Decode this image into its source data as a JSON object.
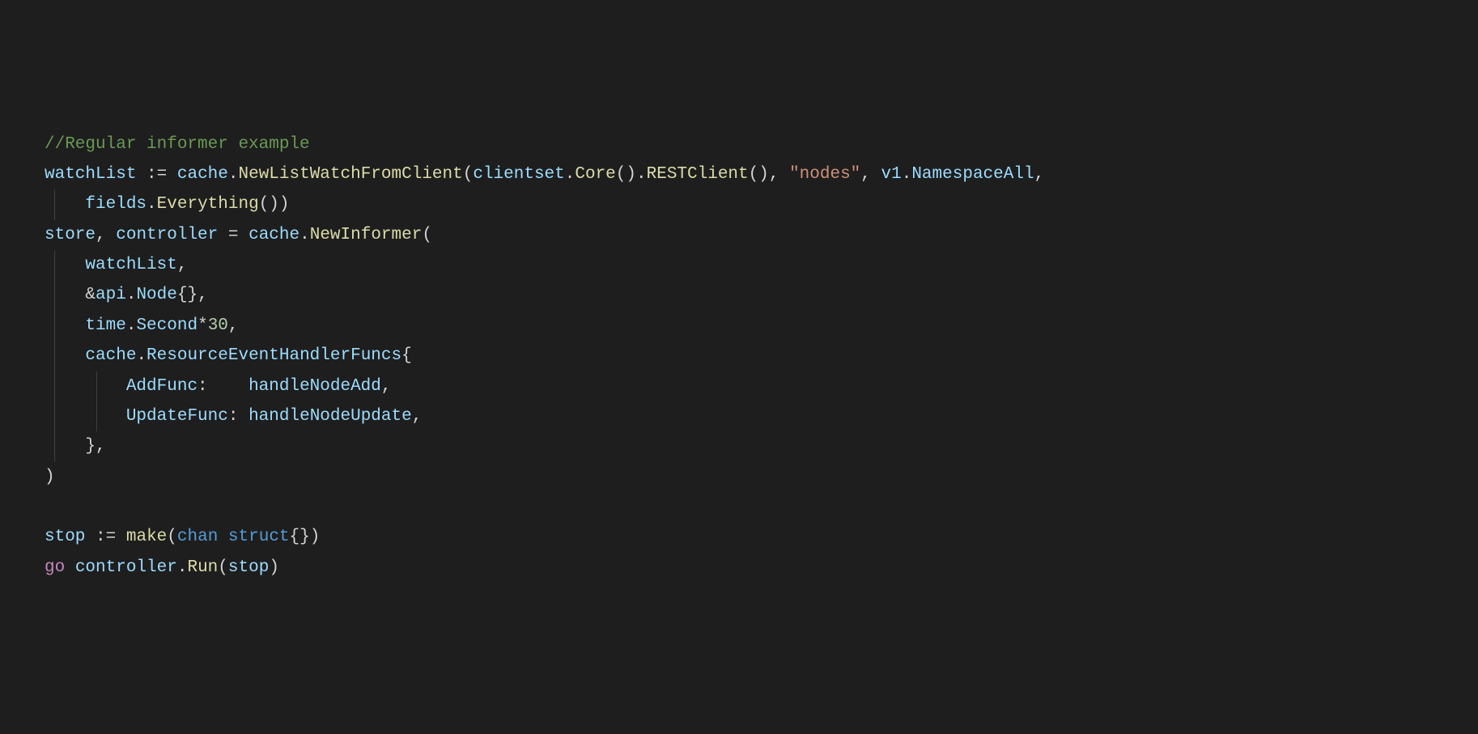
{
  "code": {
    "line1": {
      "comment": "//Regular informer example"
    },
    "line2": {
      "var1": "watchList",
      "op": ":=",
      "pkg1": "cache",
      "fn1": "NewListWatchFromClient",
      "arg1": "clientset",
      "fn2": "Core",
      "fn3": "RESTClient",
      "str": "\"nodes\"",
      "pkg2": "v1",
      "const": "NamespaceAll"
    },
    "line3": {
      "pkg": "fields",
      "fn": "Everything"
    },
    "line4": {
      "var1": "store",
      "var2": "controller",
      "op": "=",
      "pkg": "cache",
      "fn": "NewInformer"
    },
    "line5": {
      "arg": "watchList"
    },
    "line6": {
      "amp": "&",
      "pkg": "api",
      "type": "Node"
    },
    "line7": {
      "pkg": "time",
      "const": "Second",
      "op": "*",
      "num": "30"
    },
    "line8": {
      "pkg": "cache",
      "type": "ResourceEventHandlerFuncs"
    },
    "line9": {
      "prop": "AddFunc",
      "val": "handleNodeAdd"
    },
    "line10": {
      "prop": "UpdateFunc",
      "val": "handleNodeUpdate"
    },
    "line11": {
      "close": "},"
    },
    "line12": {
      "close": ")"
    },
    "line14": {
      "var": "stop",
      "op": ":=",
      "fn": "make",
      "kw": "chan",
      "kw2": "struct"
    },
    "line15": {
      "kw": "go",
      "var": "controller",
      "fn": "Run",
      "arg": "stop"
    }
  }
}
